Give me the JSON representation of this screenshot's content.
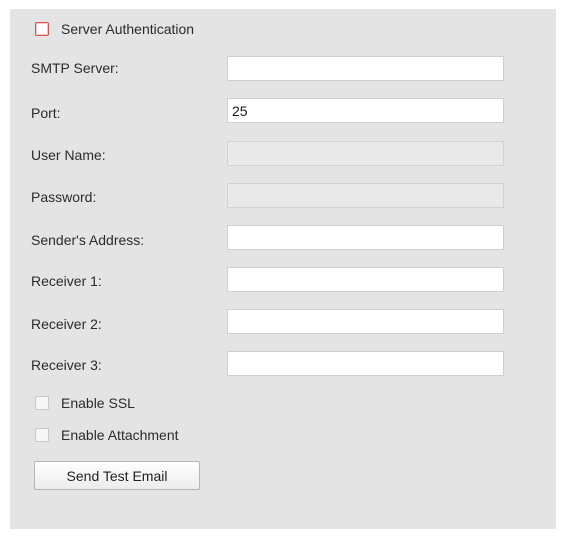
{
  "server_auth": {
    "label": "Server Authentication",
    "checked": false
  },
  "fields": {
    "smtp_server": {
      "label": "SMTP Server:",
      "value": ""
    },
    "port": {
      "label": "Port:",
      "value": "25"
    },
    "user_name": {
      "label": "User Name:",
      "value": "",
      "disabled": true
    },
    "password": {
      "label": "Password:",
      "value": "",
      "disabled": true
    },
    "sender_address": {
      "label": "Sender's Address:",
      "value": ""
    },
    "receiver_1": {
      "label": "Receiver 1:",
      "value": ""
    },
    "receiver_2": {
      "label": "Receiver 2:",
      "value": ""
    },
    "receiver_3": {
      "label": "Receiver 3:",
      "value": ""
    }
  },
  "enable_ssl": {
    "label": "Enable SSL",
    "checked": false
  },
  "enable_attachment": {
    "label": "Enable Attachment",
    "checked": false
  },
  "test_button": {
    "label": "Send Test Email"
  },
  "colors": {
    "panel_bg": "#e4e4e4",
    "highlight_border": "#d9534f",
    "disabled_field_bg": "#e9e9e9"
  }
}
